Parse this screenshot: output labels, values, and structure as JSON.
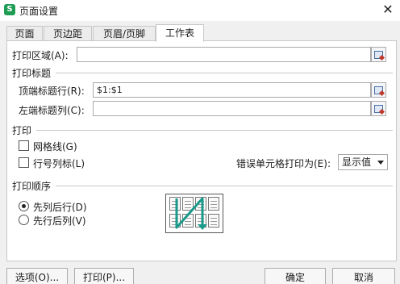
{
  "window": {
    "app_icon_letter": "S",
    "title": "页面设置",
    "close_glyph": "✕"
  },
  "tabs": [
    {
      "label": "页面",
      "active": false
    },
    {
      "label": "页边距",
      "active": false
    },
    {
      "label": "页眉/页脚",
      "active": false
    },
    {
      "label": "工作表",
      "active": true
    }
  ],
  "print_area": {
    "label": "打印区域(A):",
    "value": ""
  },
  "print_titles": {
    "section_label": "打印标题",
    "top_rows": {
      "label": "顶端标题行(R):",
      "value": "$1:$1"
    },
    "left_columns": {
      "label": "左端标题列(C):",
      "value": ""
    }
  },
  "print": {
    "section_label": "打印",
    "gridlines": {
      "label": "网格线(G)",
      "checked": false
    },
    "row_col_headers": {
      "label": "行号列标(L)",
      "checked": false
    },
    "cell_errors": {
      "label": "错误单元格打印为(E):",
      "value": "显示值"
    }
  },
  "page_order": {
    "section_label": "打印顺序",
    "down_then_over": {
      "label": "先列后行(D)",
      "selected": true
    },
    "over_then_down": {
      "label": "先行后列(V)",
      "selected": false
    },
    "arrow_color": "#1a9a8a"
  },
  "buttons": {
    "options": "选项(O)...",
    "print": "打印(P)...",
    "ok": "确定",
    "cancel": "取消"
  }
}
